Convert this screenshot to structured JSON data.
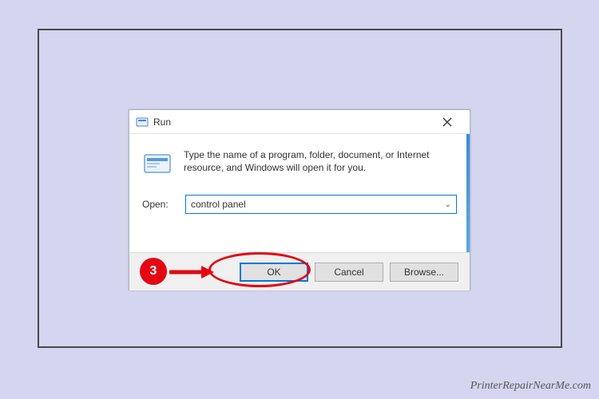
{
  "dialog": {
    "title": "Run",
    "description": "Type the name of a program, folder, document, or Internet resource, and Windows will open it for you.",
    "open_label": "Open:",
    "input_value": "control panel",
    "buttons": {
      "ok": "OK",
      "cancel": "Cancel",
      "browse": "Browse..."
    }
  },
  "annotation": {
    "step_number": "3"
  },
  "watermark": "PrinterRepairNearMe.com"
}
